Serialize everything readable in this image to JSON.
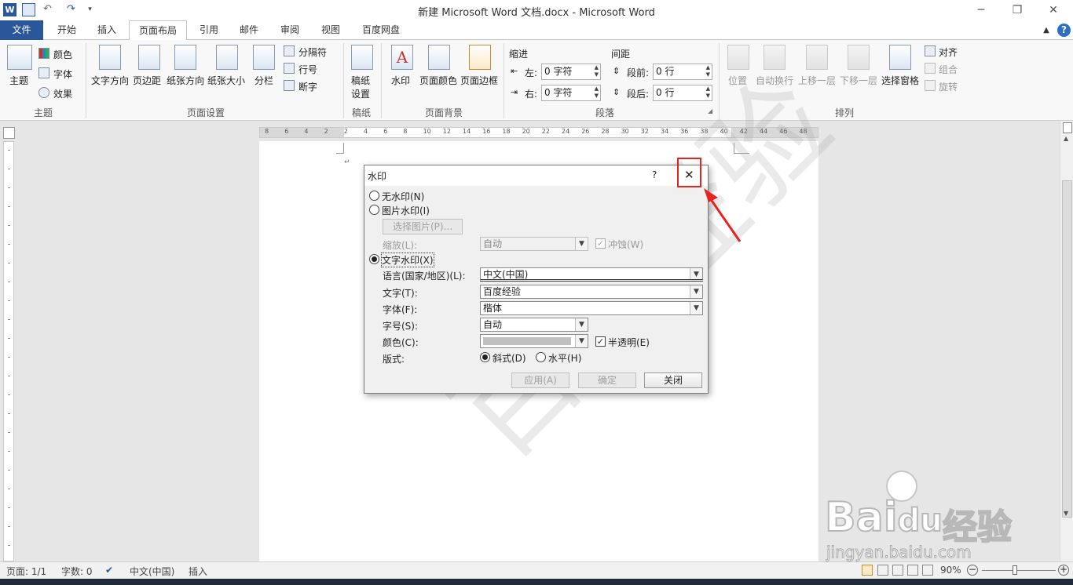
{
  "window": {
    "title": "新建 Microsoft Word 文档.docx - Microsoft Word",
    "controls": {
      "minimize": "─",
      "restore": "❐",
      "close": "✕"
    }
  },
  "tabs": [
    "文件",
    "开始",
    "插入",
    "页面布局",
    "引用",
    "邮件",
    "审阅",
    "视图",
    "百度网盘"
  ],
  "active_tab": "页面布局",
  "ribbon": {
    "theme": {
      "main": "主题",
      "colors": "颜色",
      "fonts": "字体",
      "effects": "效果",
      "label": "主题"
    },
    "page_setup": {
      "text_direction": "文字方向",
      "margins": "页边距",
      "orientation": "纸张方向",
      "size": "纸张大小",
      "columns": "分栏",
      "breaks": "分隔符",
      "line_numbers": "行号",
      "hyphenation": "断字",
      "label": "页面设置"
    },
    "manuscript": {
      "setup_line1": "稿纸",
      "setup_line2": "设置",
      "label": "稿纸"
    },
    "page_background": {
      "watermark": "水印",
      "page_color": "页面颜色",
      "page_borders": "页面边框",
      "label": "页面背景"
    },
    "paragraph": {
      "indent_title": "缩进",
      "left_label": "左:",
      "left_value": "0 字符",
      "right_label": "右:",
      "right_value": "0 字符",
      "spacing_title": "间距",
      "before_label": "段前:",
      "before_value": "0 行",
      "after_label": "段后:",
      "after_value": "0 行",
      "label": "段落"
    },
    "arrange": {
      "position": "位置",
      "wrap": "自动换行",
      "bring_forward": "上移一层",
      "send_backward": "下移一层",
      "selection_pane": "选择窗格",
      "align": "对齐",
      "group": "组合",
      "rotate": "旋转",
      "label": "排列"
    }
  },
  "ruler_ticks": [
    "8",
    "6",
    "4",
    "2",
    "2",
    "4",
    "6",
    "8",
    "10",
    "12",
    "14",
    "16",
    "18",
    "20",
    "22",
    "24",
    "26",
    "28",
    "30",
    "32",
    "34",
    "36",
    "38",
    "40",
    "42",
    "44",
    "46",
    "48"
  ],
  "dialog": {
    "title": "水印",
    "help": "?",
    "close": "✕",
    "no_watermark": "无水印(N)",
    "picture_watermark": "图片水印(I)",
    "select_picture": "选择图片(P)...",
    "scale_label": "缩放(L):",
    "scale_value": "自动",
    "washout": "冲蚀(W)",
    "text_watermark": "文字水印(X)",
    "language_label": "语言(国家/地区)(L):",
    "language_value": "中文(中国)",
    "text_label": "文字(T):",
    "text_value": "百度经验",
    "font_label": "字体(F):",
    "font_value": "楷体",
    "size_label": "字号(S):",
    "size_value": "自动",
    "color_label": "颜色(C):",
    "semitransparent": "半透明(E)",
    "layout_label": "版式:",
    "diagonal": "斜式(D)",
    "horizontal": "水平(H)",
    "apply": "应用(A)",
    "ok": "确定",
    "close_button": "关闭"
  },
  "document": {
    "watermark_text": "百度经验"
  },
  "status": {
    "page": "页面: 1/1",
    "words": "字数: 0",
    "language": "中文(中国)",
    "mode": "插入",
    "zoom": "90%"
  },
  "brand": {
    "logo_text": "Bai",
    "logo_text2": "du",
    "logo_cn": "经验",
    "site": "jingyan.baidu.com"
  },
  "colors": {
    "file_tab": "#2a579a",
    "highlight": "#e8231f"
  }
}
